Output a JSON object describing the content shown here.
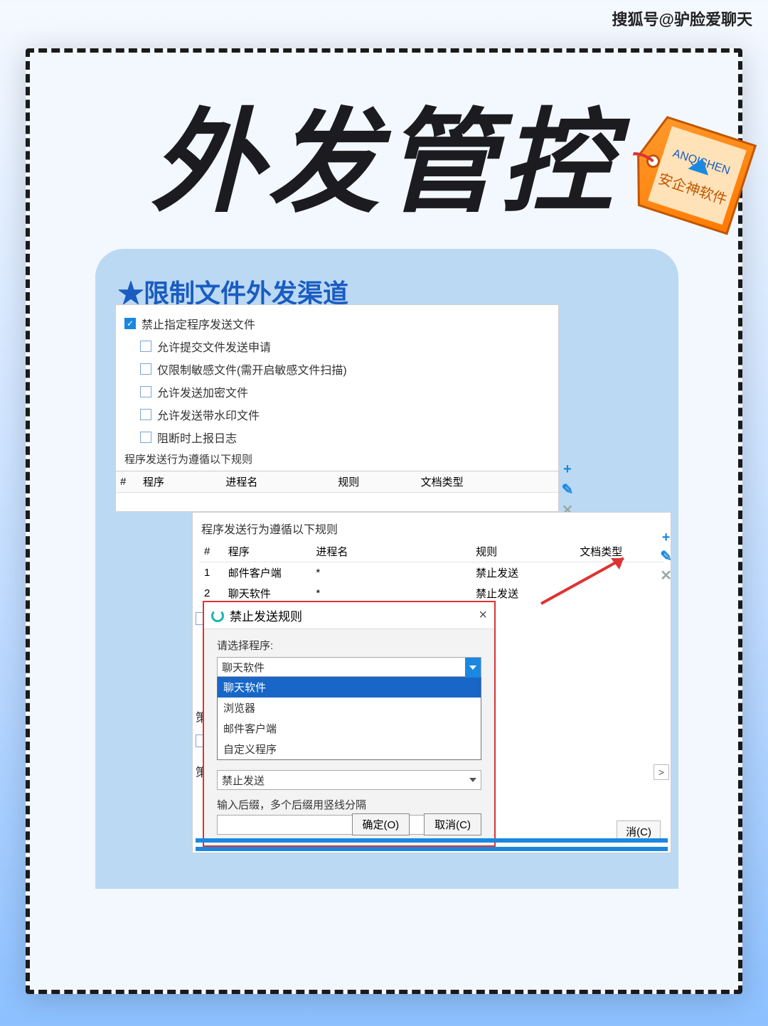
{
  "watermark": "搜狐号@驴脸爱聊天",
  "page_title": "外发管控",
  "tag_text": "安企神软件",
  "card_title": "限制文件外发渠道",
  "panel1": {
    "main_check": "禁止指定程序发送文件",
    "subs": {
      "a": "允许提交文件发送申请",
      "b": "仅限制敏感文件(需开启敏感文件扫描)",
      "c": "允许发送加密文件",
      "d": "允许发送带水印文件",
      "e": "阻断时上报日志"
    },
    "rules_note": "程序发送行为遵循以下规则",
    "headers": {
      "idx": "#",
      "prog": "程序",
      "proc": "进程名",
      "rule": "规则",
      "type": "文档类型"
    },
    "tools": {
      "add": "+",
      "edit": "✎",
      "del": "✕"
    }
  },
  "panel2": {
    "rules_note": "程序发送行为遵循以下规则",
    "headers": {
      "idx": "#",
      "prog": "程序",
      "proc": "进程名",
      "rule": "规则",
      "type": "文档类型"
    },
    "rows": [
      {
        "idx": "1",
        "prog": "邮件客户端",
        "proc": "*",
        "rule": "禁止发送",
        "type": ""
      },
      {
        "idx": "2",
        "prog": "聊天软件",
        "proc": "*",
        "rule": "禁止发送",
        "type": ""
      }
    ],
    "tools": {
      "add": "+",
      "edit": "✎",
      "del": "✕"
    },
    "scroll_right": ">",
    "cancel_ghost": "消(C)",
    "edge": {
      "lbl1": "策",
      "lbl2": "策"
    }
  },
  "dialog": {
    "title": "禁止发送规则",
    "close": "×",
    "label_program": "请选择程序:",
    "program_value": "聊天软件",
    "program_options": {
      "o1": "聊天软件",
      "o2": "浏览器",
      "o3": "邮件客户端",
      "o4": "自定义程序"
    },
    "rule_value": "禁止发送",
    "suffix_hint": "输入后缀，多个后缀用竖线分隔",
    "ok": "确定(O)",
    "cancel": "取消(C)"
  },
  "colors": {
    "accent": "#1a88e0",
    "accent_dark": "#1766c8",
    "red": "#d33",
    "teal": "#17b6b0"
  }
}
